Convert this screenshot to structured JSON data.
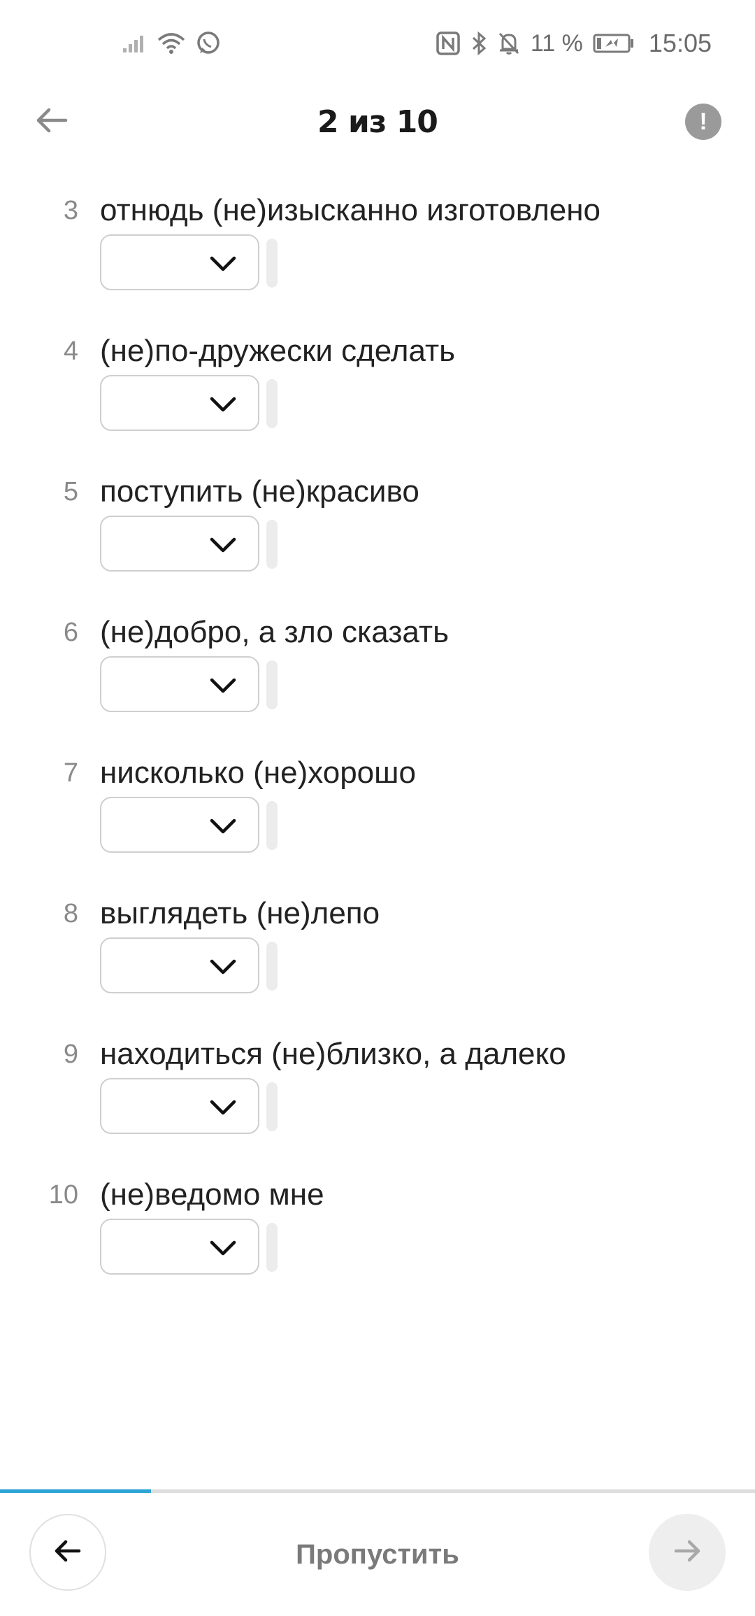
{
  "status_bar": {
    "battery_percent": "11 %",
    "time": "15:05",
    "left_icons": [
      "signal-icon",
      "wifi-icon",
      "whatsapp-icon"
    ],
    "right_icons": [
      "nfc-icon",
      "bluetooth-icon",
      "bell-off-icon",
      "battery-icon"
    ]
  },
  "header": {
    "title": "2 из 10",
    "back_icon": "arrow-left-icon",
    "info_icon": "exclamation-icon",
    "info_glyph": "!"
  },
  "questions": [
    {
      "number": "",
      "text": ""
    },
    {
      "number": "3",
      "text": "отнюдь (не)изысканно изготовлено"
    },
    {
      "number": "4",
      "text": "(не)по-дружески сделать"
    },
    {
      "number": "5",
      "text": "поступить (не)красиво"
    },
    {
      "number": "6",
      "text": "(не)добро, а зло сказать"
    },
    {
      "number": "7",
      "text": "нисколько (не)хорошо"
    },
    {
      "number": "8",
      "text": "выглядеть (не)лепо"
    },
    {
      "number": "9",
      "text": "находиться (не)близко, а далеко"
    },
    {
      "number": "10",
      "text": "(не)ведомо мне"
    }
  ],
  "progress": {
    "fraction": 0.2
  },
  "footer": {
    "skip_label": "Пропустить",
    "prev_icon": "arrow-left-icon",
    "next_icon": "arrow-right-icon"
  },
  "colors": {
    "accent": "#2ea3d6",
    "text": "#222222",
    "muted": "#8a8a8a"
  }
}
